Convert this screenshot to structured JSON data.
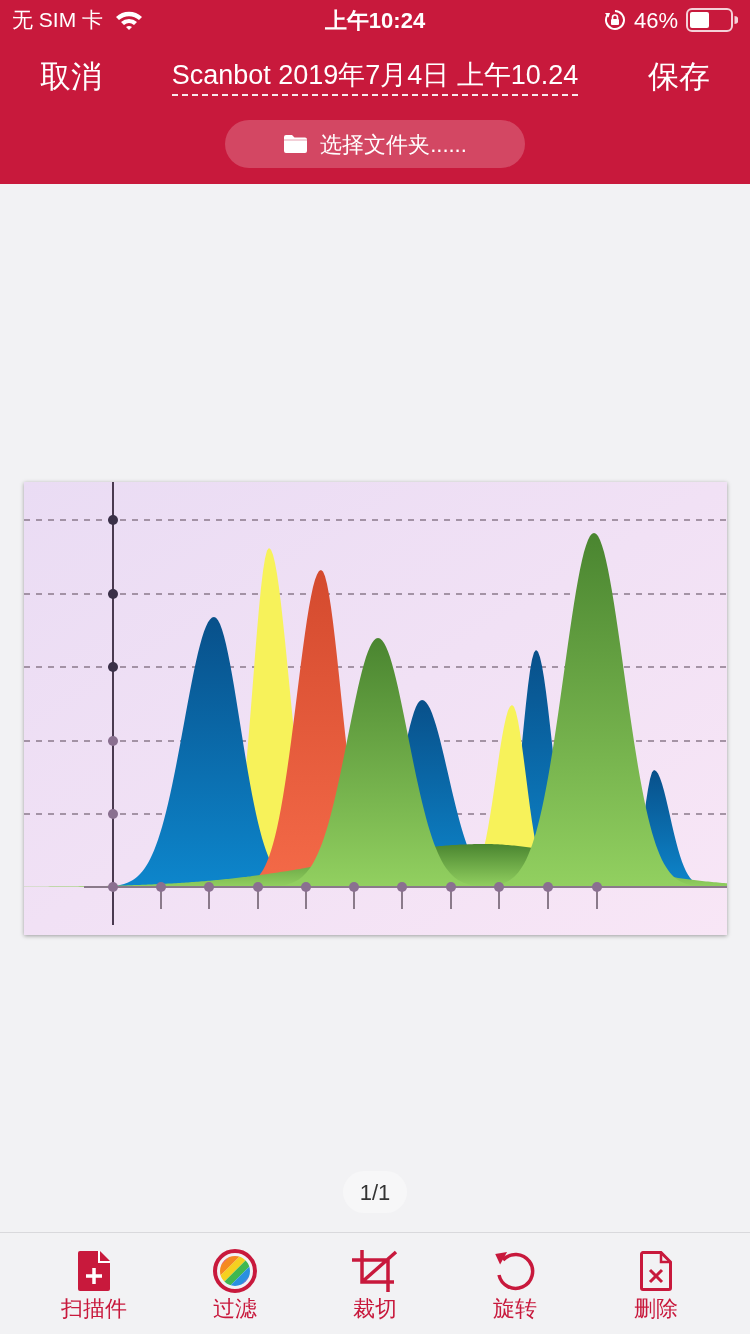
{
  "status_bar": {
    "carrier": "无 SIM 卡",
    "time": "上午10:24",
    "battery": "46%"
  },
  "header": {
    "cancel": "取消",
    "title_field": {
      "value": "Scanbot 2019年7月4日 上午10.24"
    },
    "save": "保存",
    "folder_button": "选择文件夹......"
  },
  "page": {
    "counter": "1/1"
  },
  "toolbar": [
    {
      "kind": "scan",
      "label": "扫描件"
    },
    {
      "kind": "filter",
      "label": "过滤"
    },
    {
      "kind": "crop",
      "label": "裁切"
    },
    {
      "kind": "rotate",
      "label": "旋转"
    },
    {
      "kind": "delete",
      "label": "删除"
    }
  ]
}
